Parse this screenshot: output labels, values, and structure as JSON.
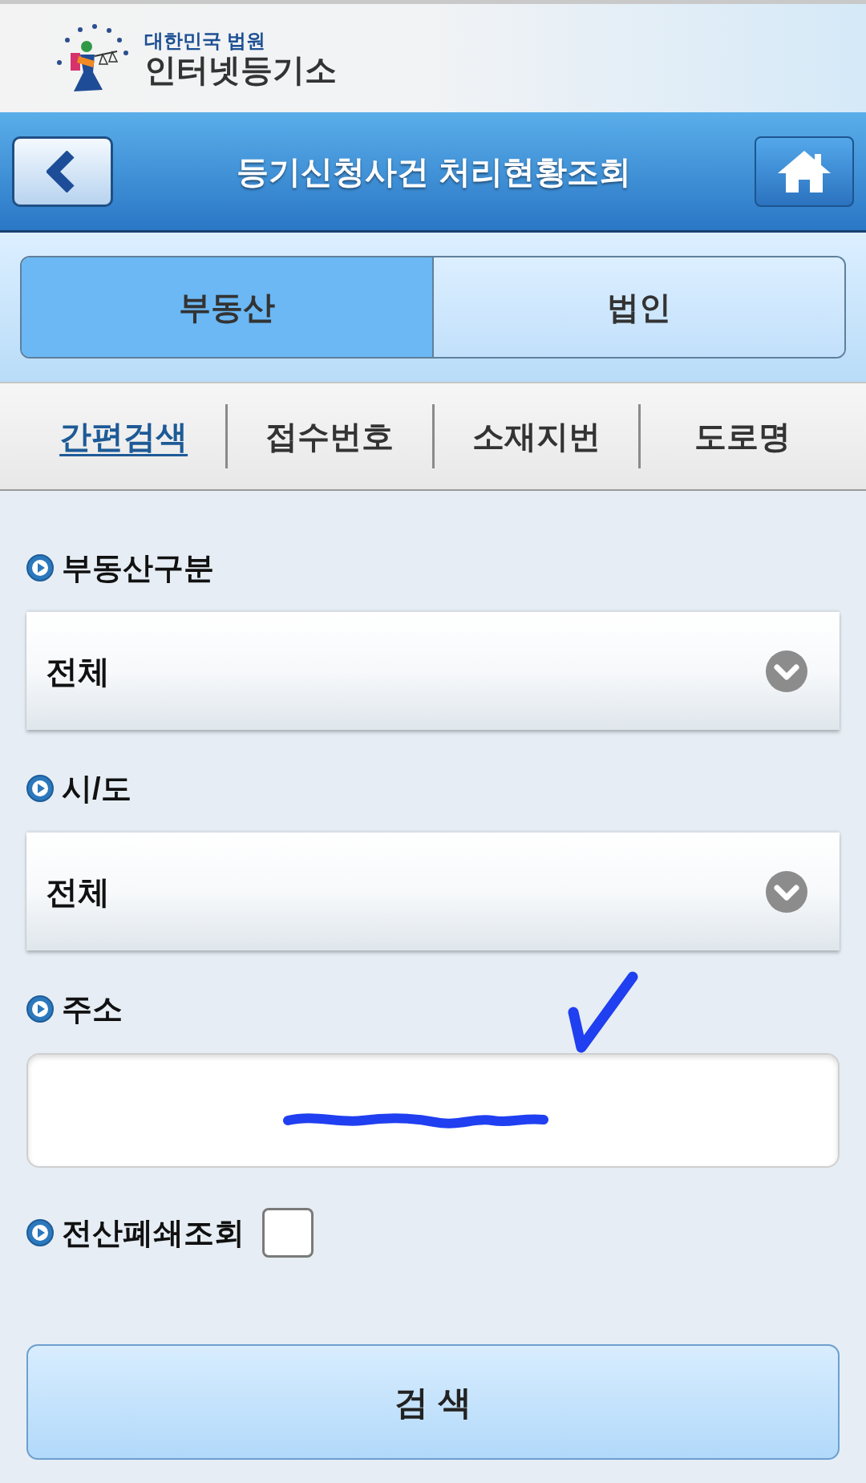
{
  "header": {
    "logo_subtitle": "대한민국 법원",
    "logo_title": "인터넷등기소"
  },
  "title_bar": {
    "title": "등기신청사건 처리현황조회"
  },
  "category_tabs": [
    {
      "label": "부동산",
      "selected": true
    },
    {
      "label": "법인",
      "selected": false
    }
  ],
  "search_tabs": [
    {
      "label": "간편검색",
      "selected": true
    },
    {
      "label": "접수번호",
      "selected": false
    },
    {
      "label": "소재지번",
      "selected": false
    },
    {
      "label": "도로명",
      "selected": false
    }
  ],
  "form": {
    "fields": [
      {
        "kind": "select",
        "label": "부동산구분",
        "value": "전체"
      },
      {
        "kind": "select",
        "label": "시/도",
        "value": "전체"
      },
      {
        "kind": "text",
        "label": "주소"
      },
      {
        "kind": "checkbox",
        "label": "전산폐쇄조회",
        "checked": false
      }
    ]
  },
  "search_button": {
    "label": "검 색"
  }
}
